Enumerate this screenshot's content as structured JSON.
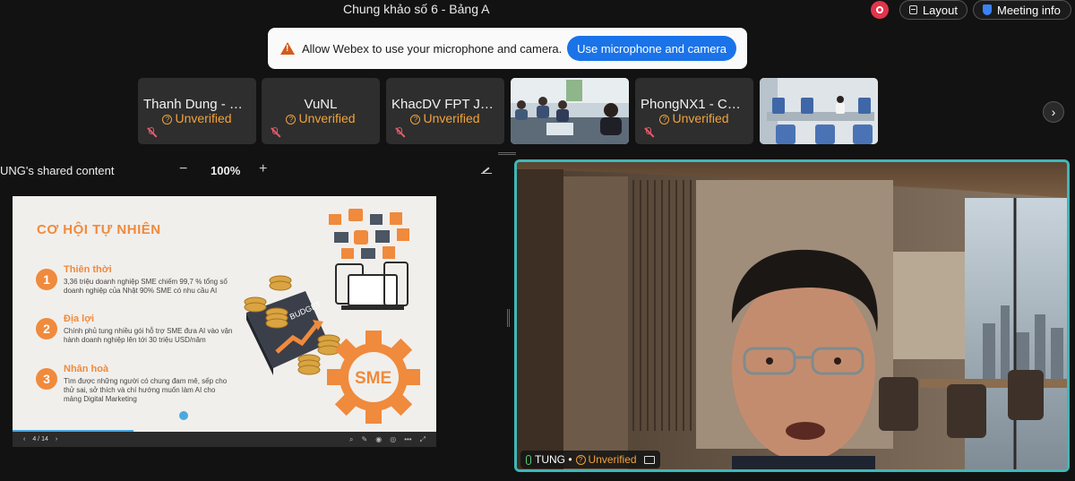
{
  "header": {
    "title": "Chung khảo số 6 - Bảng A",
    "layout_label": "Layout",
    "meeting_info_label": "Meeting info"
  },
  "banner": {
    "text": "Allow Webex to use your microphone and camera.",
    "button_label": "Use microphone and camera"
  },
  "participants": [
    {
      "name": "Thanh Dung - Ch...",
      "status": "Unverified"
    },
    {
      "name": "VuNL",
      "status": "Unverified"
    },
    {
      "name": "KhacDV FPT Jap...",
      "status": "Unverified"
    },
    {
      "name": "PhongNX1 - CAI...",
      "status": "Unverified"
    }
  ],
  "share": {
    "label": "UNG's shared content",
    "zoom_out": "−",
    "zoom_level": "100%",
    "zoom_in": "+"
  },
  "slide": {
    "title": "CƠ HỘI TỰ NHIÊN",
    "items": [
      {
        "num": "1",
        "heading": "Thiên thời",
        "body": "3,36 triệu doanh nghiệp SME chiếm 99,7 % tổng số doanh nghiệp của Nhật 90% SME có nhu cầu AI"
      },
      {
        "num": "2",
        "heading": "Địa lợi",
        "body": "Chính phủ tung nhiều gói hỗ trợ SME đưa AI vào vận hành doanh nghiệp lên tới 30 triệu USD/năm"
      },
      {
        "num": "3",
        "heading": "Nhân hoà",
        "body": "Tìm được những người có chung đam mê, sếp cho thử sai, sở thích và chí hướng muốn làm AI cho mảng Digital Marketing"
      }
    ],
    "budget_label": "BUDGET",
    "sme_label": "SME",
    "page_indicator": "4 / 14",
    "progress": 0.286
  },
  "speaker": {
    "name": "TUNG •",
    "status": "Unverified"
  },
  "colors": {
    "accent_orange": "#f08a3c",
    "status_orange": "#f0a33c",
    "active_border": "#3fb7b7",
    "primary_blue": "#1a73e8",
    "record_red": "#e2344a"
  }
}
